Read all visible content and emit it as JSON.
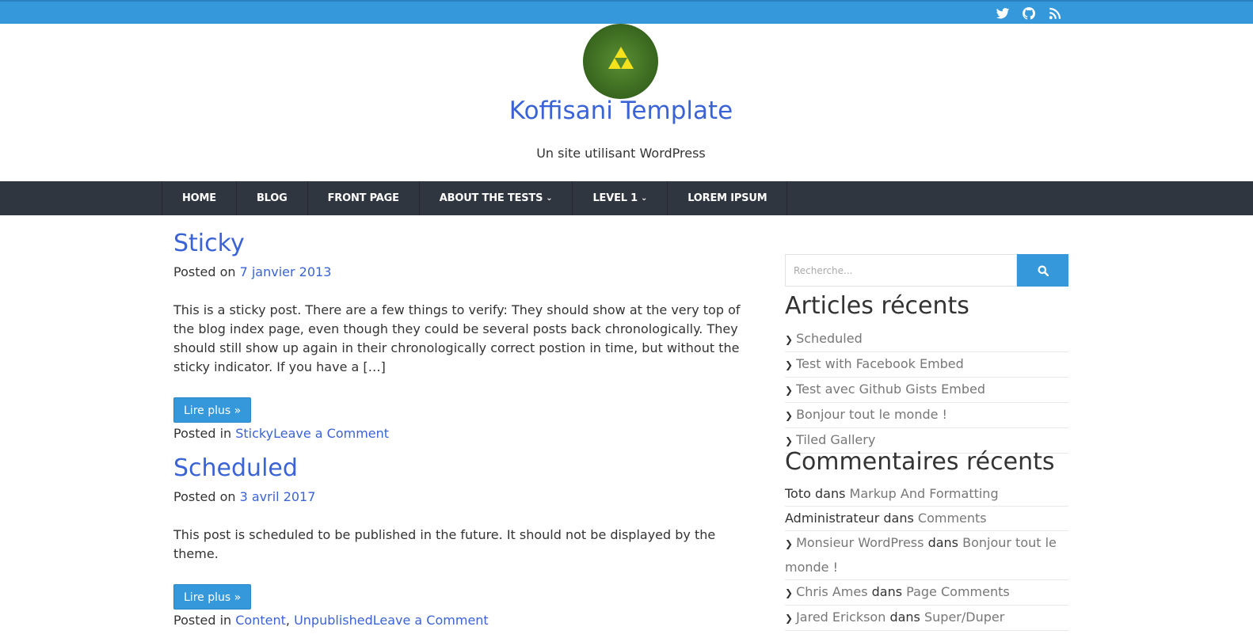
{
  "social": {
    "icons": [
      "twitter-icon",
      "github-icon",
      "rss-icon"
    ]
  },
  "site": {
    "title": "Koffisani Template",
    "tagline": "Un site utilisant WordPress"
  },
  "nav": {
    "items": [
      {
        "label": "HOME",
        "dropdown": false
      },
      {
        "label": "BLOG",
        "dropdown": false
      },
      {
        "label": "FRONT PAGE",
        "dropdown": false
      },
      {
        "label": "ABOUT THE TESTS",
        "dropdown": true
      },
      {
        "label": "LEVEL 1",
        "dropdown": true
      },
      {
        "label": "LOREM IPSUM",
        "dropdown": false
      }
    ]
  },
  "posts": [
    {
      "title": "Sticky",
      "posted_on_label": "Posted on",
      "date": "7 janvier 2013",
      "excerpt": "This is a sticky post. There are a few things to verify: They should show at the very top of the blog index page, even though they could be several posts back chronologically. They should still show up again in their chronologically correct postion in time, but without the sticky indicator. If you have a […]",
      "read_more": "Lire plus »",
      "posted_in_label": "Posted in",
      "categories": [
        "Sticky"
      ],
      "comment_link": "Leave a Comment"
    },
    {
      "title": "Scheduled",
      "posted_on_label": "Posted on",
      "date": "3 avril 2017",
      "excerpt": "This post is scheduled to be published in the future. It should not be displayed by the theme.",
      "read_more": "Lire plus »",
      "posted_in_label": "Posted in",
      "categories": [
        "Content",
        "Unpublished"
      ],
      "comment_link": "Leave a Comment"
    }
  ],
  "sidebar": {
    "search_placeholder": "Recherche...",
    "recent_posts_title": "Articles récents",
    "recent_posts": [
      "Scheduled",
      "Test with Facebook Embed",
      "Test avec Github Gists Embed",
      "Bonjour tout le monde !",
      "Tiled Gallery"
    ],
    "recent_comments_title": "Commentaires récents",
    "dans": "dans",
    "recent_comments": [
      {
        "author": "Toto",
        "author_link": false,
        "post": "Markup And Formatting",
        "arrow": false
      },
      {
        "author": "Administrateur",
        "author_link": false,
        "post": "Comments",
        "arrow": false
      },
      {
        "author": "Monsieur WordPress",
        "author_link": true,
        "post": "Bonjour tout le monde !",
        "arrow": true
      },
      {
        "author": "Chris Ames",
        "author_link": true,
        "post": "Page Comments",
        "arrow": true
      },
      {
        "author": "Jared Erickson",
        "author_link": true,
        "post": "Super/Duper",
        "arrow": true
      }
    ]
  }
}
